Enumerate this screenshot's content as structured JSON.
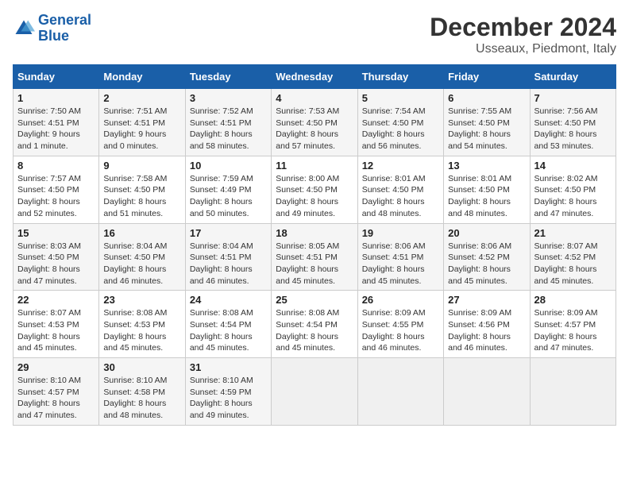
{
  "logo": {
    "line1": "General",
    "line2": "Blue"
  },
  "title": "December 2024",
  "subtitle": "Usseaux, Piedmont, Italy",
  "headers": [
    "Sunday",
    "Monday",
    "Tuesday",
    "Wednesday",
    "Thursday",
    "Friday",
    "Saturday"
  ],
  "weeks": [
    [
      {
        "day": "1",
        "info": "Sunrise: 7:50 AM\nSunset: 4:51 PM\nDaylight: 9 hours\nand 1 minute."
      },
      {
        "day": "2",
        "info": "Sunrise: 7:51 AM\nSunset: 4:51 PM\nDaylight: 9 hours\nand 0 minutes."
      },
      {
        "day": "3",
        "info": "Sunrise: 7:52 AM\nSunset: 4:51 PM\nDaylight: 8 hours\nand 58 minutes."
      },
      {
        "day": "4",
        "info": "Sunrise: 7:53 AM\nSunset: 4:50 PM\nDaylight: 8 hours\nand 57 minutes."
      },
      {
        "day": "5",
        "info": "Sunrise: 7:54 AM\nSunset: 4:50 PM\nDaylight: 8 hours\nand 56 minutes."
      },
      {
        "day": "6",
        "info": "Sunrise: 7:55 AM\nSunset: 4:50 PM\nDaylight: 8 hours\nand 54 minutes."
      },
      {
        "day": "7",
        "info": "Sunrise: 7:56 AM\nSunset: 4:50 PM\nDaylight: 8 hours\nand 53 minutes."
      }
    ],
    [
      {
        "day": "8",
        "info": "Sunrise: 7:57 AM\nSunset: 4:50 PM\nDaylight: 8 hours\nand 52 minutes."
      },
      {
        "day": "9",
        "info": "Sunrise: 7:58 AM\nSunset: 4:50 PM\nDaylight: 8 hours\nand 51 minutes."
      },
      {
        "day": "10",
        "info": "Sunrise: 7:59 AM\nSunset: 4:49 PM\nDaylight: 8 hours\nand 50 minutes."
      },
      {
        "day": "11",
        "info": "Sunrise: 8:00 AM\nSunset: 4:50 PM\nDaylight: 8 hours\nand 49 minutes."
      },
      {
        "day": "12",
        "info": "Sunrise: 8:01 AM\nSunset: 4:50 PM\nDaylight: 8 hours\nand 48 minutes."
      },
      {
        "day": "13",
        "info": "Sunrise: 8:01 AM\nSunset: 4:50 PM\nDaylight: 8 hours\nand 48 minutes."
      },
      {
        "day": "14",
        "info": "Sunrise: 8:02 AM\nSunset: 4:50 PM\nDaylight: 8 hours\nand 47 minutes."
      }
    ],
    [
      {
        "day": "15",
        "info": "Sunrise: 8:03 AM\nSunset: 4:50 PM\nDaylight: 8 hours\nand 47 minutes."
      },
      {
        "day": "16",
        "info": "Sunrise: 8:04 AM\nSunset: 4:50 PM\nDaylight: 8 hours\nand 46 minutes."
      },
      {
        "day": "17",
        "info": "Sunrise: 8:04 AM\nSunset: 4:51 PM\nDaylight: 8 hours\nand 46 minutes."
      },
      {
        "day": "18",
        "info": "Sunrise: 8:05 AM\nSunset: 4:51 PM\nDaylight: 8 hours\nand 45 minutes."
      },
      {
        "day": "19",
        "info": "Sunrise: 8:06 AM\nSunset: 4:51 PM\nDaylight: 8 hours\nand 45 minutes."
      },
      {
        "day": "20",
        "info": "Sunrise: 8:06 AM\nSunset: 4:52 PM\nDaylight: 8 hours\nand 45 minutes."
      },
      {
        "day": "21",
        "info": "Sunrise: 8:07 AM\nSunset: 4:52 PM\nDaylight: 8 hours\nand 45 minutes."
      }
    ],
    [
      {
        "day": "22",
        "info": "Sunrise: 8:07 AM\nSunset: 4:53 PM\nDaylight: 8 hours\nand 45 minutes."
      },
      {
        "day": "23",
        "info": "Sunrise: 8:08 AM\nSunset: 4:53 PM\nDaylight: 8 hours\nand 45 minutes."
      },
      {
        "day": "24",
        "info": "Sunrise: 8:08 AM\nSunset: 4:54 PM\nDaylight: 8 hours\nand 45 minutes."
      },
      {
        "day": "25",
        "info": "Sunrise: 8:08 AM\nSunset: 4:54 PM\nDaylight: 8 hours\nand 45 minutes."
      },
      {
        "day": "26",
        "info": "Sunrise: 8:09 AM\nSunset: 4:55 PM\nDaylight: 8 hours\nand 46 minutes."
      },
      {
        "day": "27",
        "info": "Sunrise: 8:09 AM\nSunset: 4:56 PM\nDaylight: 8 hours\nand 46 minutes."
      },
      {
        "day": "28",
        "info": "Sunrise: 8:09 AM\nSunset: 4:57 PM\nDaylight: 8 hours\nand 47 minutes."
      }
    ],
    [
      {
        "day": "29",
        "info": "Sunrise: 8:10 AM\nSunset: 4:57 PM\nDaylight: 8 hours\nand 47 minutes."
      },
      {
        "day": "30",
        "info": "Sunrise: 8:10 AM\nSunset: 4:58 PM\nDaylight: 8 hours\nand 48 minutes."
      },
      {
        "day": "31",
        "info": "Sunrise: 8:10 AM\nSunset: 4:59 PM\nDaylight: 8 hours\nand 49 minutes."
      },
      {
        "day": "",
        "info": ""
      },
      {
        "day": "",
        "info": ""
      },
      {
        "day": "",
        "info": ""
      },
      {
        "day": "",
        "info": ""
      }
    ]
  ]
}
